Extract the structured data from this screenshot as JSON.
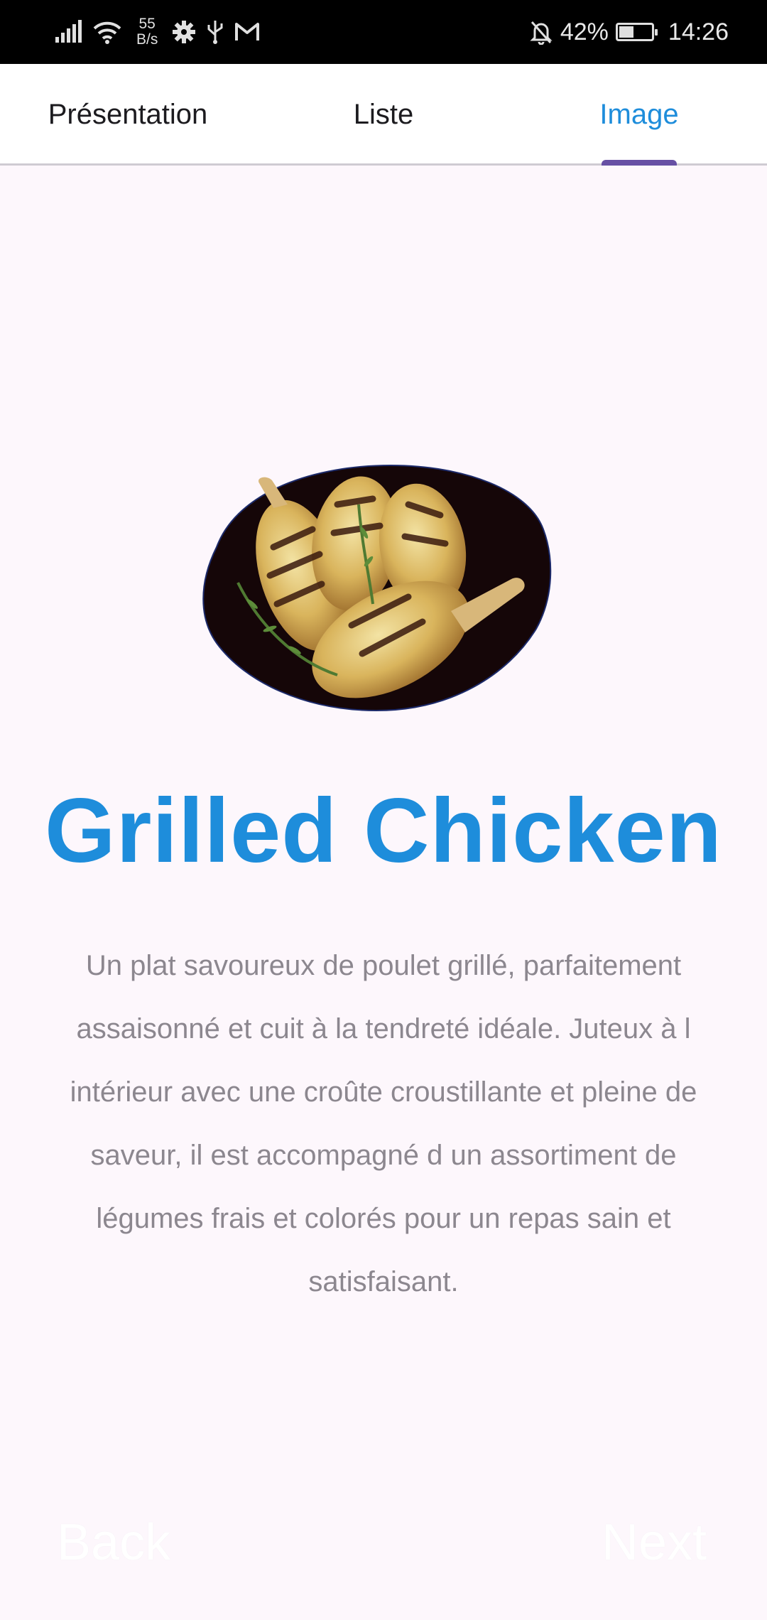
{
  "status_bar": {
    "net_speed_value": "55",
    "net_speed_unit": "B/s",
    "battery": "42%",
    "time": "14:26"
  },
  "tabs": [
    {
      "label": "Présentation",
      "selected": false
    },
    {
      "label": "Liste",
      "selected": false
    },
    {
      "label": "Image",
      "selected": true
    }
  ],
  "colors": {
    "accent": "#1e8ddb",
    "indicator": "#6750a4",
    "background": "#fdf7fc",
    "body_text": "#8c878f"
  },
  "main": {
    "image_icon": "grilled-chicken-image",
    "title": "Grilled Chicken",
    "description": "Un plat savoureux de poulet grillé, parfaitement assaisonné et cuit à la tendreté idéale. Juteux à l intérieur avec une croûte croustillante et pleine de saveur, il est accompagné d un assortiment de légumes frais et colorés pour un repas sain et satisfaisant."
  },
  "footer": {
    "back_label": "Back",
    "next_label": "Next"
  }
}
